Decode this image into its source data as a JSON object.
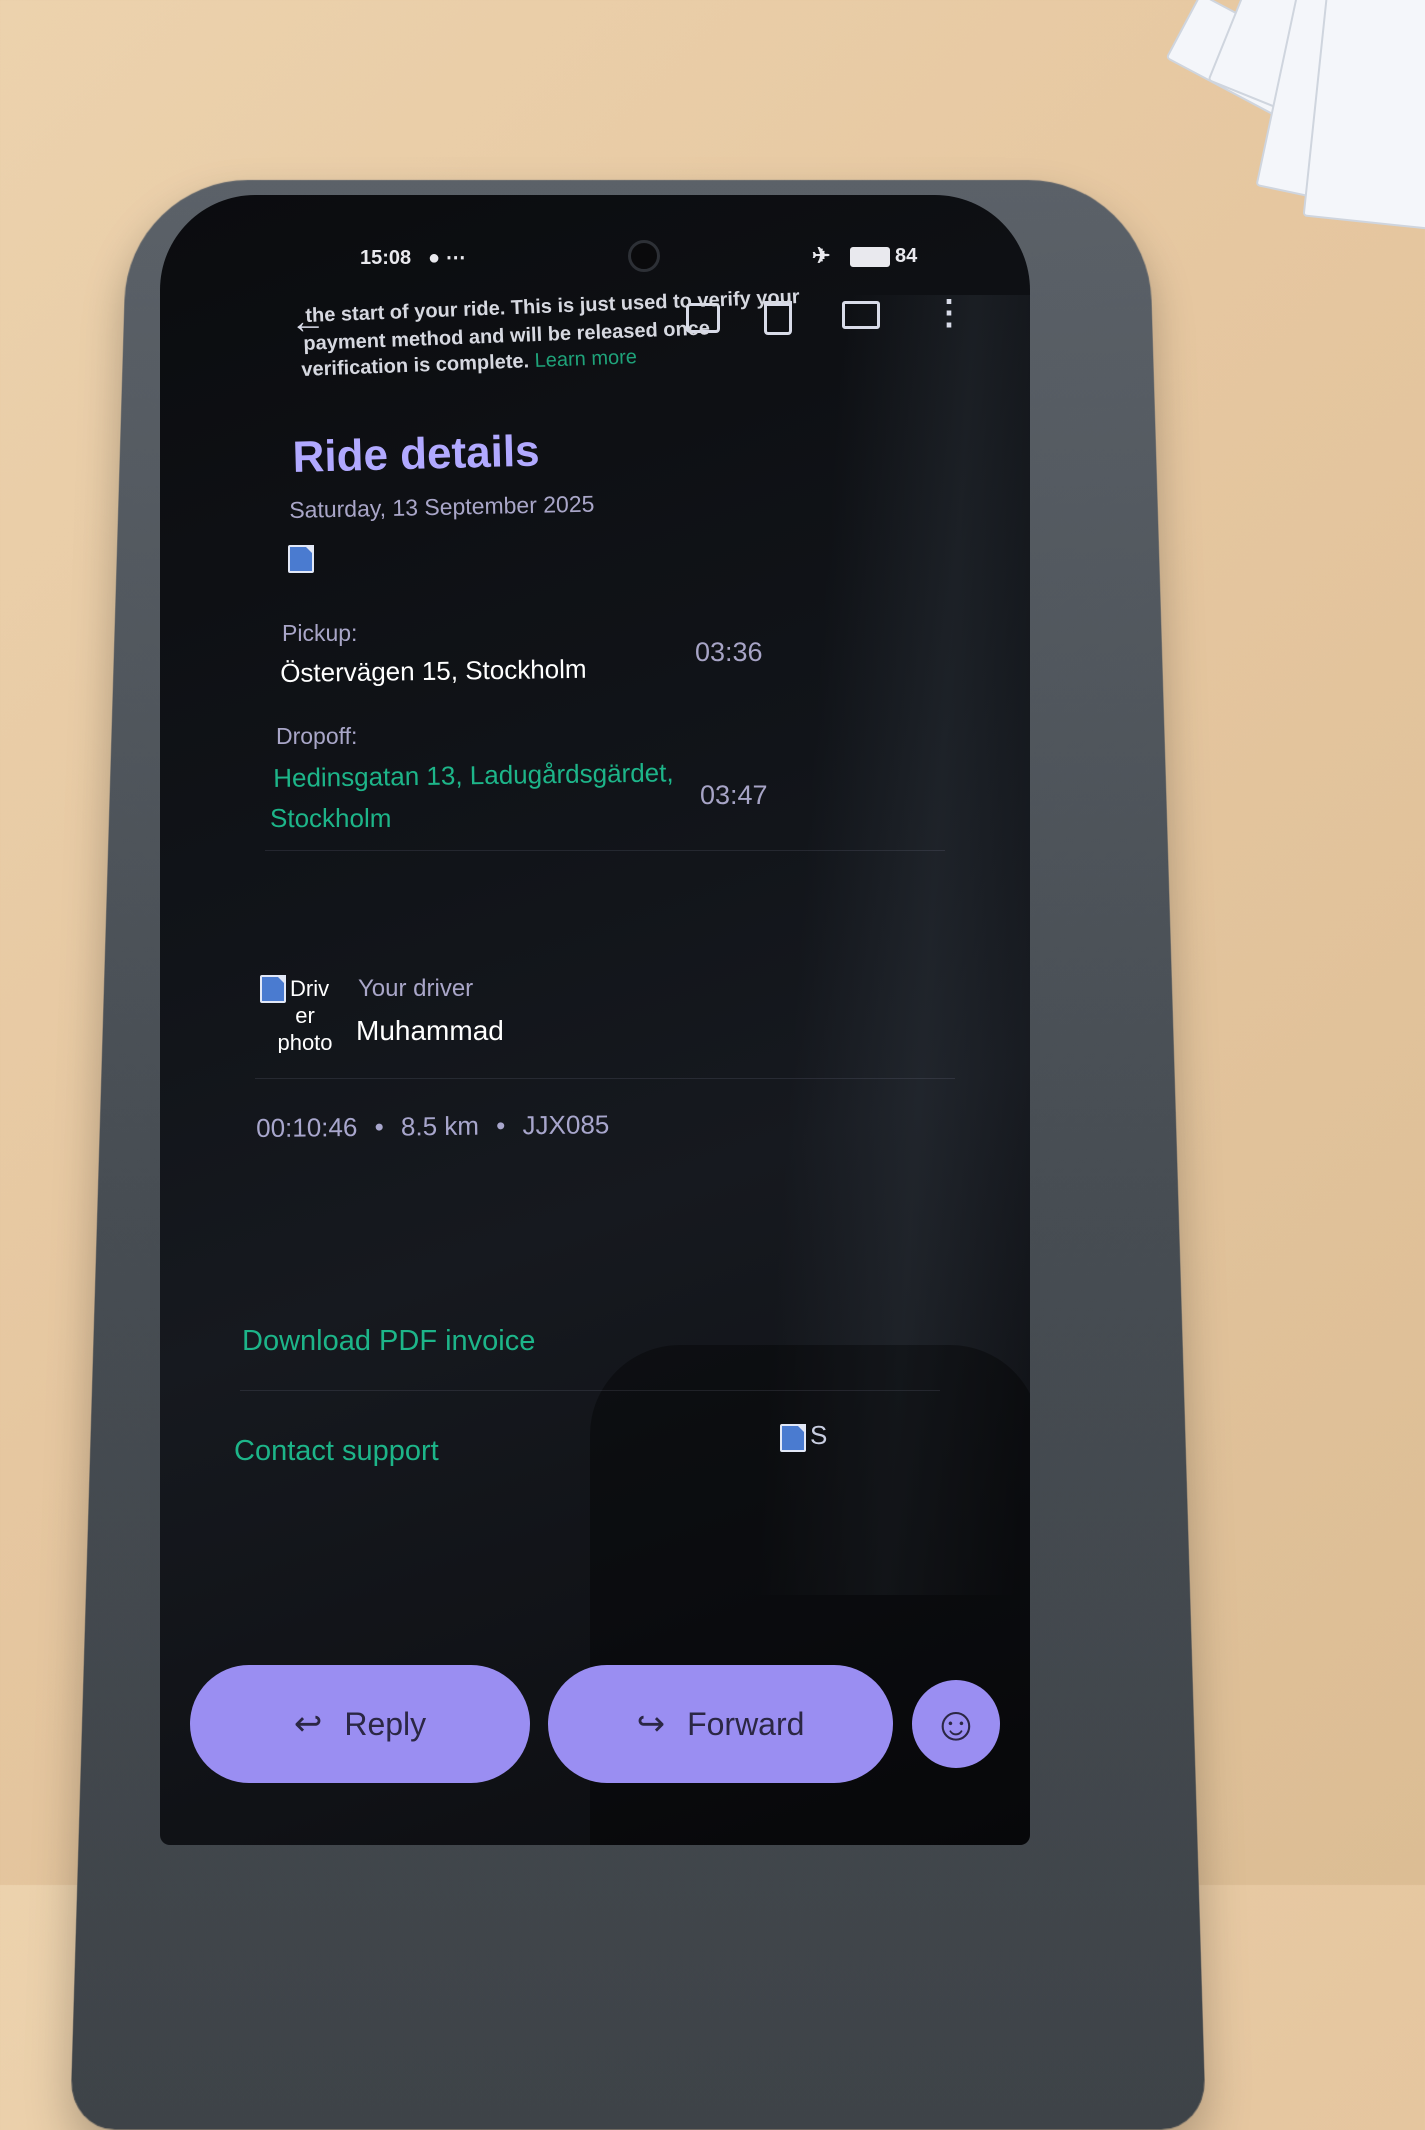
{
  "status_bar": {
    "time": "15:08",
    "battery": "84"
  },
  "email": {
    "intro_line1": "the start of your ride. This is just used to verify your",
    "intro_line2": "payment method and will be released once",
    "intro_line3": "verification is complete.",
    "learn_more": "Learn more"
  },
  "ride": {
    "title": "Ride details",
    "date": "Saturday, 13 September 2025",
    "pickup_label": "Pickup:",
    "pickup_address": "Östervägen 15, Stockholm",
    "pickup_time": "03:36",
    "dropoff_label": "Dropoff:",
    "dropoff_address_line1": "Hedinsgatan 13, Ladugårdsgärdet,",
    "dropoff_address_line2": "Stockholm",
    "dropoff_time": "03:47",
    "driver_photo_alt_1": "Driv",
    "driver_photo_alt_2": "er",
    "driver_photo_alt_3": "photo",
    "driver_label": "Your driver",
    "driver_name": "Muhammad",
    "duration": "00:10:46",
    "distance": "8.5 km",
    "plate": "JJX085",
    "separator": "•"
  },
  "links": {
    "download_invoice": "Download PDF invoice",
    "contact_support": "Contact support",
    "support_img_alt": "S"
  },
  "actions": {
    "reply": "Reply",
    "forward": "Forward"
  },
  "icons": {
    "back": "arrow-left-icon",
    "archive": "archive-icon",
    "delete": "trash-icon",
    "mark_unread": "mail-unread-icon",
    "more": "more-vertical-icon",
    "reply": "reply-icon",
    "forward": "forward-icon",
    "emoji": "smiley-icon"
  },
  "colors": {
    "accent": "#9a8ef2",
    "title": "#b1a9ff",
    "link": "#1db589",
    "screen_bg": "#111419"
  }
}
